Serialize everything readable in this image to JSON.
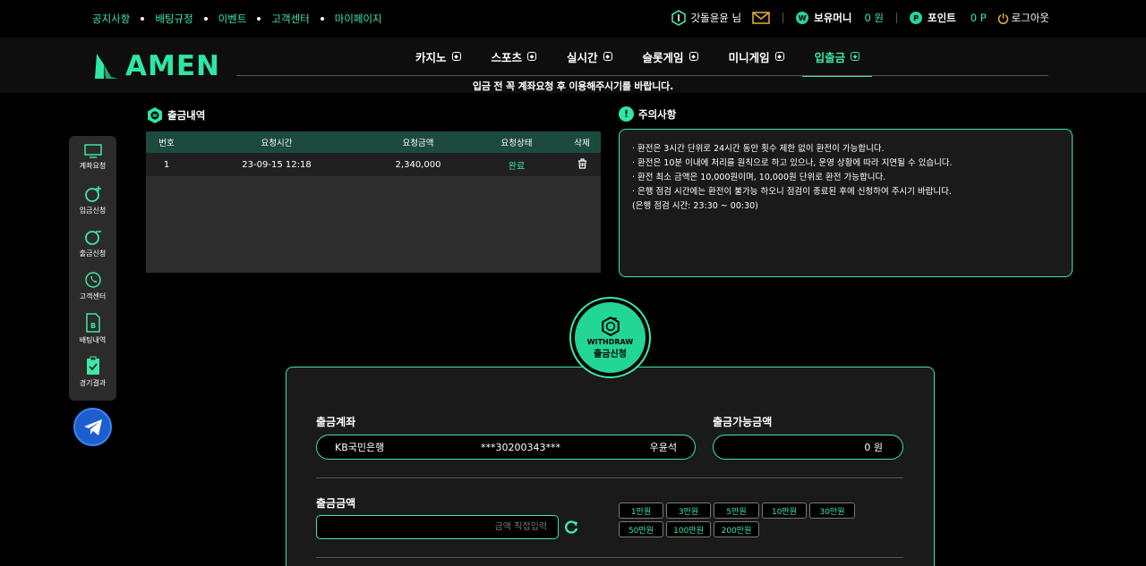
{
  "top": {
    "links": [
      "공지사항",
      "배팅규정",
      "이벤트",
      "고객센터",
      "마이페이지"
    ],
    "username": "갓돌윤윤 님",
    "money_label": "보유머니",
    "money_value": "0 원",
    "point_label": "포인트",
    "point_value": "0 P",
    "logout": "로그아웃"
  },
  "nav": {
    "logo": "AMEN",
    "menu": [
      "카지노",
      "스포츠",
      "실시간",
      "슬롯게임",
      "미니게임",
      "입출금"
    ],
    "active": "입출금",
    "notice": "입금 전 꼭 계좌요청 후 이용해주시기를 바랍니다."
  },
  "sidebar": {
    "items": [
      "계좌요청",
      "입금신청",
      "출금신청",
      "고객센터",
      "배팅내역",
      "경기결과"
    ]
  },
  "history": {
    "title": "출금내역",
    "headers": [
      "번호",
      "요청시간",
      "요청금액",
      "요청상태",
      "삭제"
    ],
    "rows": [
      {
        "no": "1",
        "time": "23-09-15 12:18",
        "amount": "2,340,000",
        "status": "완료"
      }
    ]
  },
  "caution": {
    "title": "주의사항",
    "lines": [
      "· 환전은 3시간 단위로 24시간 동안 횟수 제한 없이 환전이 가능합니다.",
      "· 환전은 10분 이내에 처리를 원칙으로 하고 있으나, 운영 상황에 따라 지연될 수 있습니다.",
      "· 환전 최소 금액은 10,000원이며, 10,000원 단위로 환전 가능합니다.",
      "· 은행 점검 시간에는 환전이 불가능 하오니 점검이 종료된 후에 신청하여 주시기 바랍니다.",
      "(은행 점검 시간: 23:30 ~ 00:30)"
    ]
  },
  "badge": {
    "en": "WITHDRAW",
    "ko": "출금신청"
  },
  "form": {
    "account_label": "출금계좌",
    "bank": "KB국민은행",
    "account_no": "***30200343***",
    "holder": "우윤석",
    "available_label": "출금가능금액",
    "available_value": "0 원",
    "amount_label": "출금금액",
    "amount_placeholder": "금액 직접입력",
    "quick": [
      "1만원",
      "3만원",
      "5만원",
      "10만원",
      "30만원",
      "50만원",
      "100만원",
      "200만원"
    ]
  }
}
